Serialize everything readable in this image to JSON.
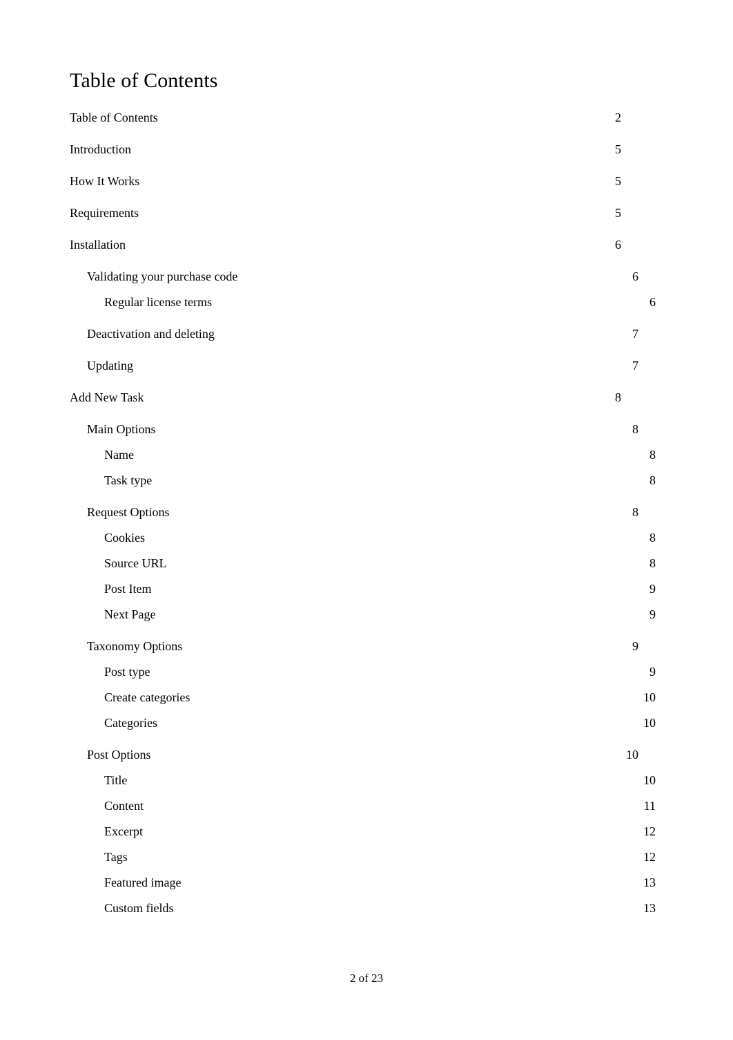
{
  "document": {
    "title": "Table of Contents",
    "footer": "2 of 23"
  },
  "colors": {
    "text": "#000000",
    "muted": "#9a9a9a",
    "background": "#ffffff"
  },
  "toc": {
    "entries": [
      {
        "label": "Table of Contents",
        "page": "2",
        "level": 1
      },
      {
        "label": "Introduction",
        "page": "5",
        "level": 1
      },
      {
        "label": "How It Works",
        "page": "5",
        "level": 1
      },
      {
        "label": "Requirements",
        "page": "5",
        "level": 1
      },
      {
        "label": "Installation",
        "page": "6",
        "level": 1
      },
      {
        "label": "Validating your purchase code",
        "page": "6",
        "level": 2
      },
      {
        "label": "Regular license terms",
        "page": "6",
        "level": 3
      },
      {
        "label": "Deactivation and deleting",
        "page": "7",
        "level": 2
      },
      {
        "label": "Updating",
        "page": "7",
        "level": 2
      },
      {
        "label": "Add New Task",
        "page": "8",
        "level": 1
      },
      {
        "label": "Main Options",
        "page": "8",
        "level": 2
      },
      {
        "label": "Name",
        "page": "8",
        "level": 3
      },
      {
        "label": "Task type",
        "page": "8",
        "level": 3
      },
      {
        "label": "Request Options",
        "page": "8",
        "level": 2
      },
      {
        "label": "Cookies",
        "page": "8",
        "level": 3
      },
      {
        "label": "Source URL",
        "page": "8",
        "level": 3
      },
      {
        "label": "Post Item",
        "page": "9",
        "level": 3
      },
      {
        "label": "Next Page",
        "page": "9",
        "level": 3
      },
      {
        "label": "Taxonomy Options",
        "page": "9",
        "level": 2
      },
      {
        "label": "Post type",
        "page": "9",
        "level": 3
      },
      {
        "label": "Create categories",
        "page": "10",
        "level": 3
      },
      {
        "label": "Categories",
        "page": "10",
        "level": 3
      },
      {
        "label": "Post Options",
        "page": "10",
        "level": 2
      },
      {
        "label": "Title",
        "page": "10",
        "level": 3
      },
      {
        "label": "Content",
        "page": "11",
        "level": 3
      },
      {
        "label": "Excerpt",
        "page": "12",
        "level": 3
      },
      {
        "label": "Tags",
        "page": "12",
        "level": 3
      },
      {
        "label": "Featured image",
        "page": "13",
        "level": 3
      },
      {
        "label": "Custom fields",
        "page": "13",
        "level": 3
      }
    ]
  }
}
